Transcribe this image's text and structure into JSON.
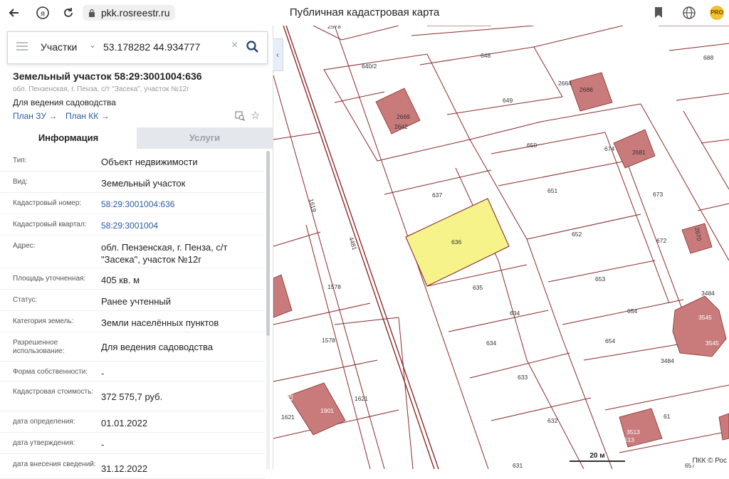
{
  "browser": {
    "url": "pkk.rosreestr.ru",
    "page_title": "Публичная кадастровая карта",
    "extension_badge": "PRO",
    "icons": [
      "back-arrow-icon",
      "yandex-icon",
      "reload-icon",
      "lock-icon",
      "bookmark-icon",
      "globe-icon"
    ]
  },
  "search": {
    "type": "Участки",
    "value": "53.178282 44.934777"
  },
  "object": {
    "title": "Земельный участок 58:29:3001004:636",
    "address": "обл. Пензенская, г. Пенза, с/т \"Засека\", участок №12г",
    "purpose": "Для ведения садоводства",
    "plan_zu": "План ЗУ",
    "plan_kk": "План КК"
  },
  "tabs": {
    "info": "Информация",
    "services": "Услуги"
  },
  "rows": [
    {
      "key": "Тип:",
      "value": "Объект недвижимости"
    },
    {
      "key": "Вид:",
      "value": "Земельный участок"
    },
    {
      "key": "Кадастровый номер:",
      "value": "58:29:3001004:636"
    },
    {
      "key": "Кадастровый квартал:",
      "value": "58:29:3001004"
    },
    {
      "key": "Адрес:",
      "value": "обл. Пензенская, г. Пенза, с/т \"Засека\", участок №12г"
    },
    {
      "key": "Площадь уточненная:",
      "value": "405 кв. м"
    },
    {
      "key": "Статус:",
      "value": "Ранее учтенный"
    },
    {
      "key": "Категория земель:",
      "value": "Земли населённых пунктов"
    },
    {
      "key": "Разрешенное использование:",
      "value": "Для ведения садоводства"
    },
    {
      "key": "Форма собственности:",
      "value": "-"
    },
    {
      "key": "Кадастровая стоимость:",
      "value": "372 575,7 руб."
    },
    {
      "key": "дата определения:",
      "value": "01.01.2022"
    },
    {
      "key": "дата утверждения:",
      "value": "-"
    },
    {
      "key": "дата внесения сведений:",
      "value": "31.12.2022"
    }
  ],
  "map": {
    "scale_label": "20 м",
    "attribution": "ПКК © Рос",
    "selected_parcel": "636",
    "highlight_color": "#f6f38a",
    "building_color": "#c97b7b",
    "parcel_labels": [
      "2578",
      "648",
      "688",
      "640/2",
      "649",
      "2664",
      "2688",
      "2669",
      "2642",
      "650",
      "674",
      "2681",
      "637",
      "651",
      "673",
      "1619",
      "4481",
      "636",
      "652",
      "672",
      "2670",
      "1578",
      "635",
      "653",
      "3484",
      "3545",
      "634",
      "654",
      "1578",
      "634",
      "654",
      "3545",
      "3484",
      "633",
      "1621",
      "1621",
      "1901",
      "1901",
      "632",
      "61",
      "3513",
      "3513",
      "631",
      "657"
    ]
  }
}
